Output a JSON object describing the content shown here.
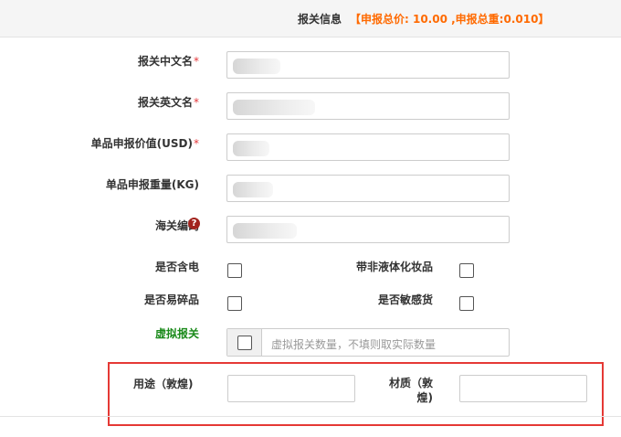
{
  "header": {
    "title": "报关信息",
    "summary": "【申报总价: 10.00 ,申报总重:0.010】"
  },
  "fields": {
    "cn_name": {
      "label": "报关中文名",
      "required": "*",
      "value": ""
    },
    "en_name": {
      "label": "报关英文名",
      "required": "*",
      "value": ""
    },
    "unit_price": {
      "label": "单品申报价值(USD)",
      "required": "*",
      "value": ""
    },
    "unit_weight": {
      "label": "单品申报重量(KG)",
      "value": ""
    },
    "hs_code": {
      "label": "海关编码",
      "help_icon": "question-circle-icon",
      "help_glyph": "?",
      "value": ""
    }
  },
  "checks": {
    "has_battery": {
      "label": "是否含电",
      "checked": false
    },
    "non_liquid_cosmetic": {
      "label": "带非液体化妆品",
      "checked": false
    },
    "fragile": {
      "label": "是否易碎品",
      "checked": false
    },
    "sensitive": {
      "label": "是否敏感货",
      "checked": false
    }
  },
  "virtual": {
    "label": "虚拟报关",
    "placeholder": "虚拟报关数量，不填则取实际数量",
    "checked": false
  },
  "dunhuang": {
    "usage_label": "用途（敦煌)",
    "material_label_line1": "材质（敦",
    "material_label_line2": "煌)",
    "usage_value": "",
    "material_value": ""
  },
  "colors": {
    "accent_orange": "#ff6a00",
    "required_red": "#e4393c",
    "help_icon_red": "#a2231d",
    "highlight_red": "#e53935",
    "virtual_green": "#1a8a1a"
  }
}
